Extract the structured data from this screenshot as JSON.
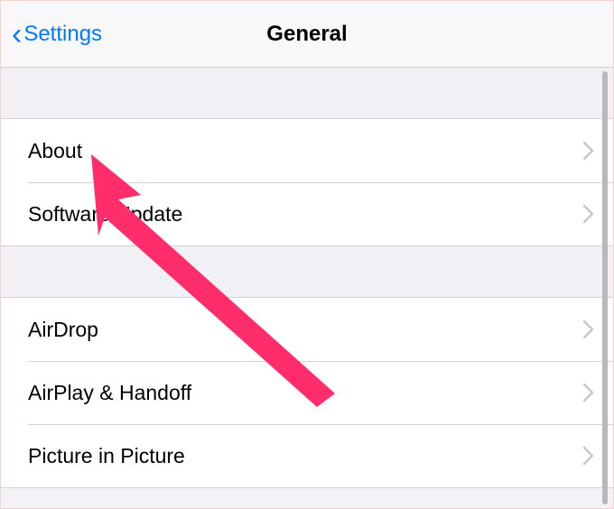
{
  "header": {
    "back_label": "Settings",
    "title": "General"
  },
  "groups": [
    {
      "rows": [
        {
          "label": "About"
        },
        {
          "label": "Software Update"
        }
      ]
    },
    {
      "rows": [
        {
          "label": "AirDrop"
        },
        {
          "label": "AirPlay & Handoff"
        },
        {
          "label": "Picture in Picture"
        }
      ]
    }
  ],
  "annotation": {
    "color": "#ff2d6b",
    "target": "about-row"
  }
}
